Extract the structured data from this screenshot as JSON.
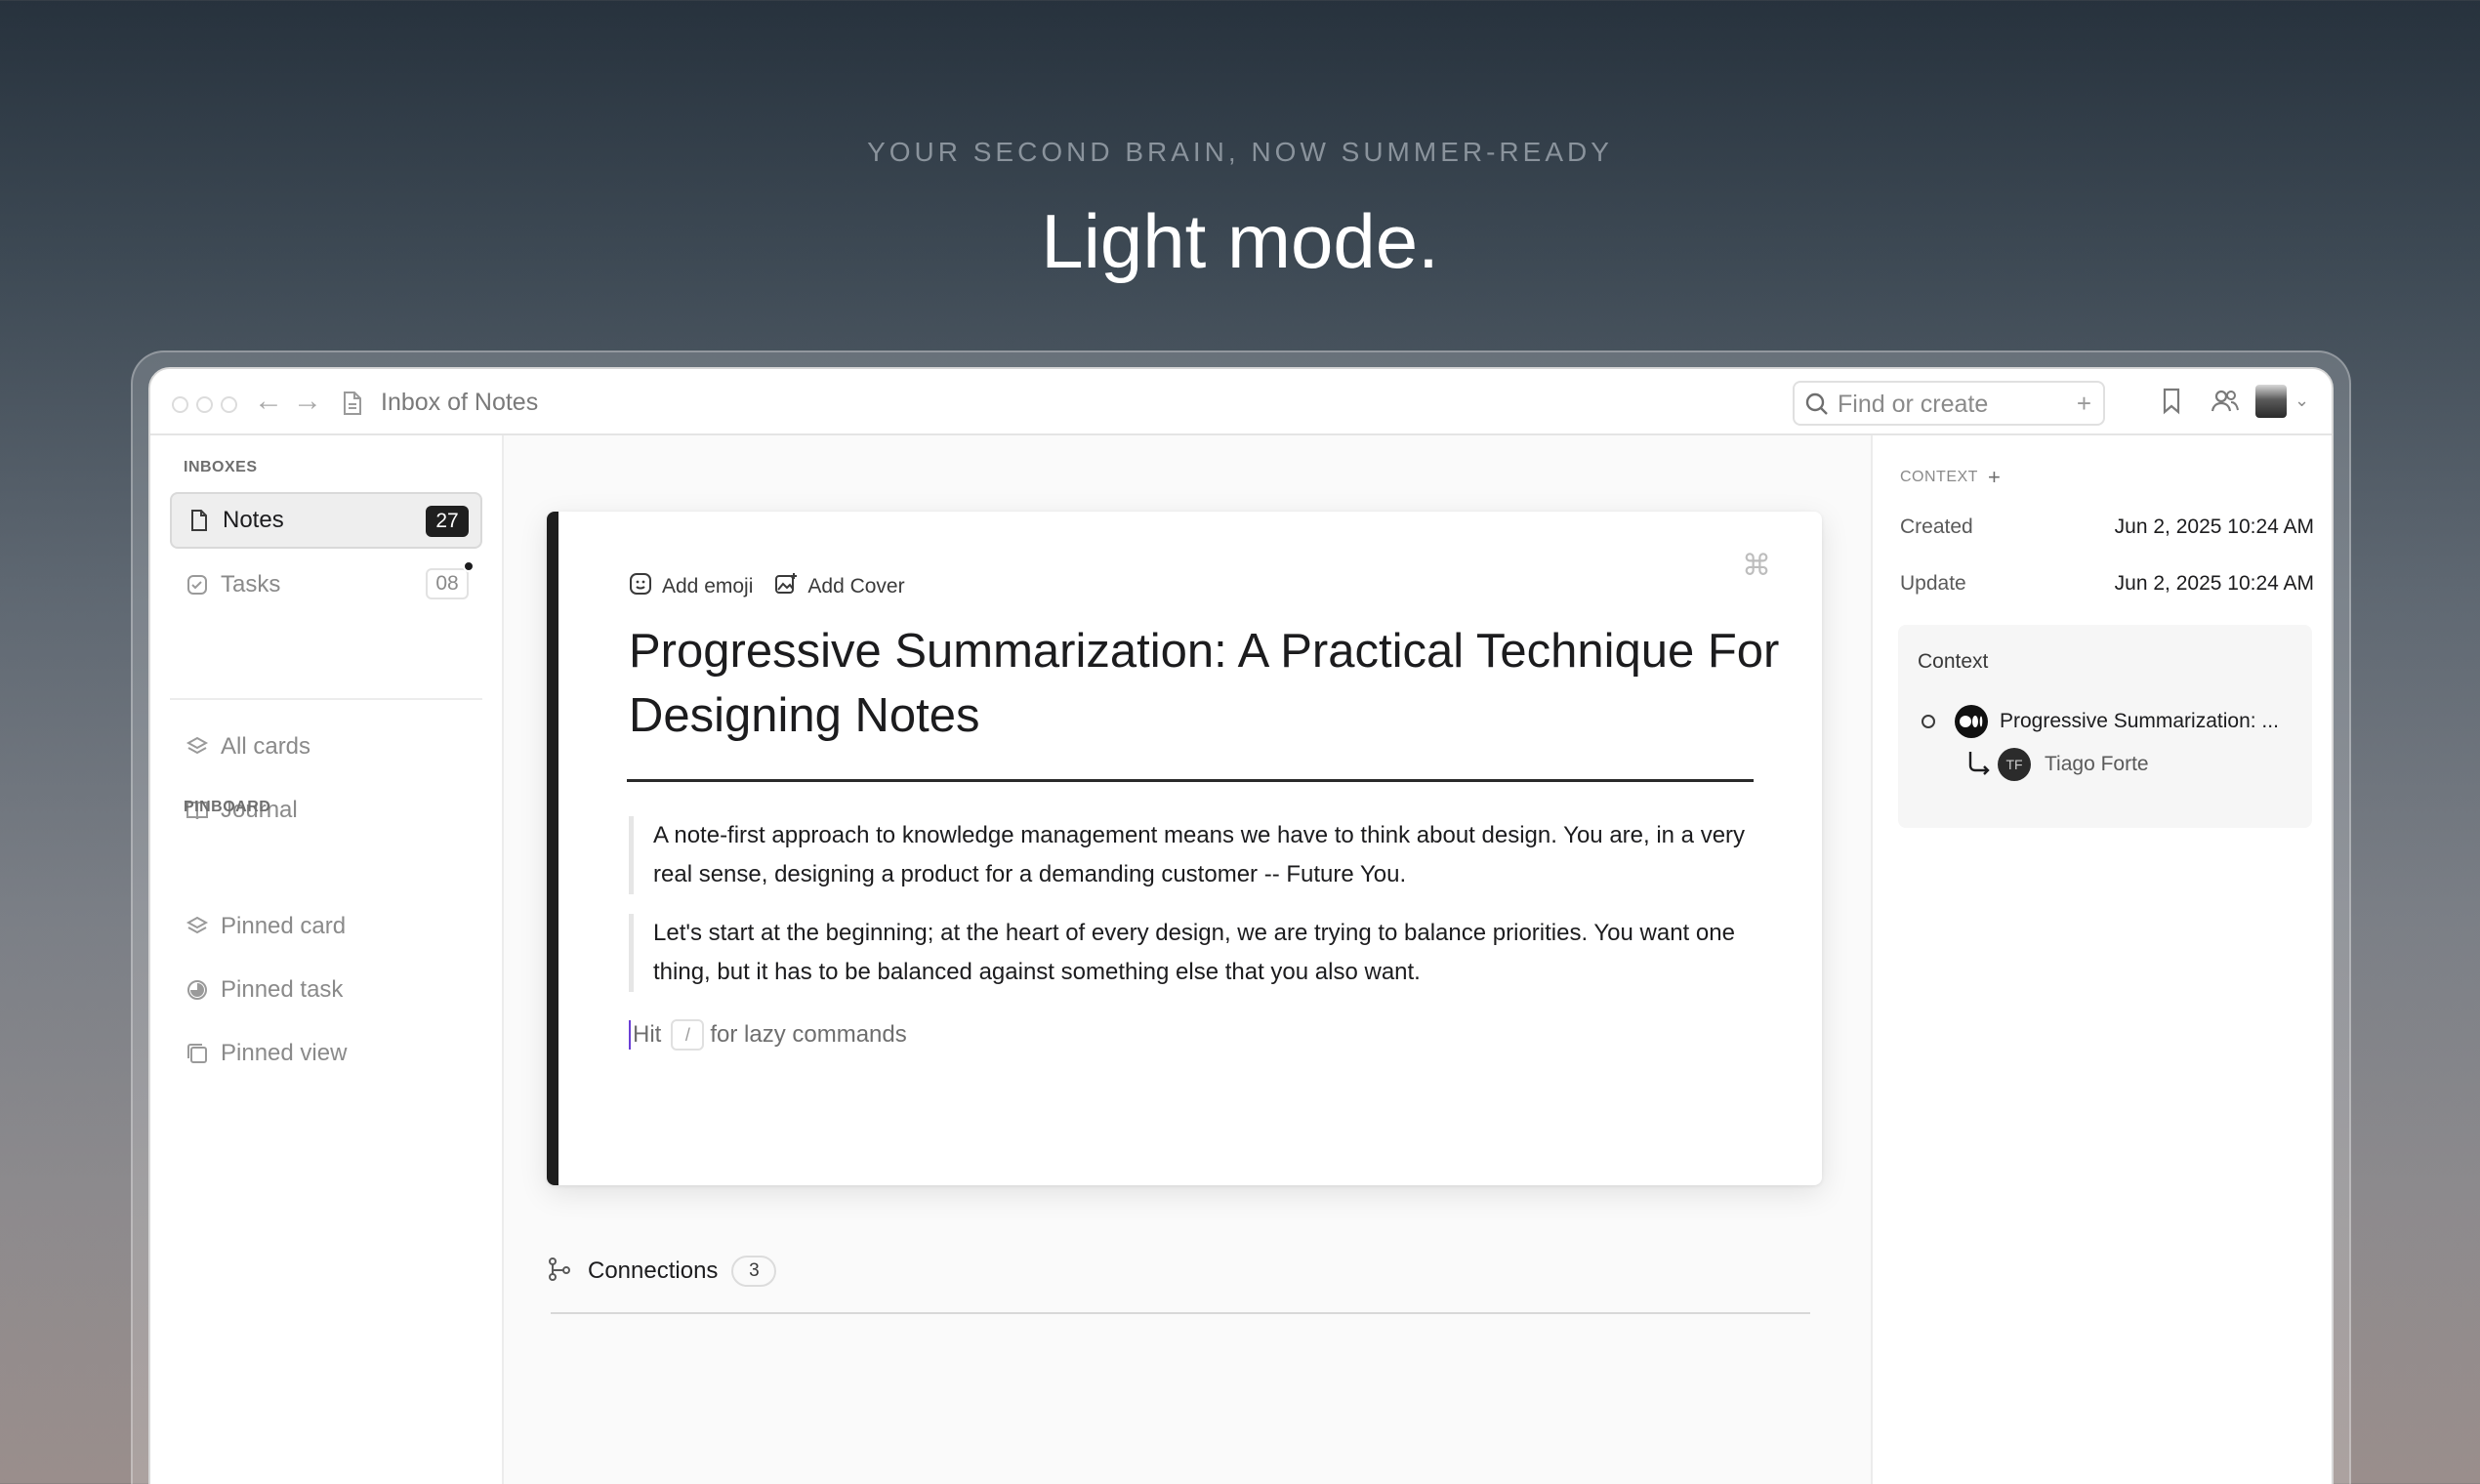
{
  "hero": {
    "eyebrow": "YOUR SECOND BRAIN, NOW SUMMER-READY",
    "title": "Light mode."
  },
  "titlebar": {
    "breadcrumb": "Inbox of Notes",
    "search_placeholder": "Find or create",
    "search_plus": "+"
  },
  "sidebar": {
    "inboxes_label": "INBOXES",
    "pinboard_label": "PINBOARD",
    "notes": {
      "label": "Notes",
      "count": "27"
    },
    "tasks": {
      "label": "Tasks",
      "count": "08"
    },
    "all_cards": "All cards",
    "journal": "Journal",
    "pinned_card": "Pinned card",
    "pinned_task": "Pinned task",
    "pinned_view": "Pinned view"
  },
  "note": {
    "add_emoji": "Add emoji",
    "add_cover": "Add Cover",
    "title": "Progressive Summarization: A Practical Technique For Designing Notes",
    "quote1": "A note-first approach to knowledge management means we have to think about design. You are, in a very real sense, designing a product for a demanding customer -- Future You.",
    "quote2": "Let's start at the beginning; at the heart of every design, we are trying to balance priorities. You want one thing, but it has to be balanced against something else that you also want.",
    "hint_pre": "Hit",
    "hint_key": "/",
    "hint_post": "for lazy commands"
  },
  "connections": {
    "label": "Connections",
    "count": "3"
  },
  "context_panel": {
    "header": "CONTEXT",
    "plus": "+",
    "created_label": "Created",
    "created_value": "Jun 2, 2025 10:24 AM",
    "update_label": "Update",
    "update_value": "Jun 2, 2025 10:24 AM",
    "box_title": "Context",
    "item1": "Progressive Summarization: ...",
    "item2_initials": "TF",
    "item2": "Tiago Forte"
  }
}
